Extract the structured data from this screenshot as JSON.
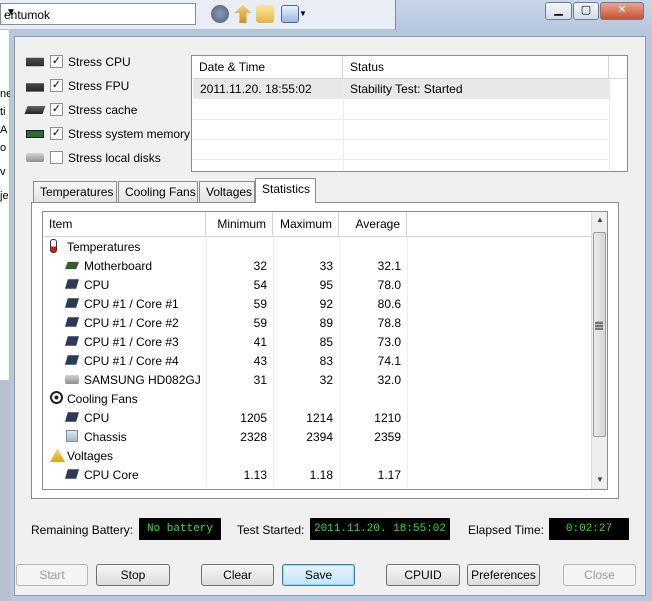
{
  "background_window": {
    "address_text": "entumok",
    "left_strip_texts": [
      "ne",
      "ti",
      "A",
      "o",
      "v",
      "je"
    ]
  },
  "stress_options": [
    {
      "icon": "cpu-chip-icon",
      "label": "Stress CPU",
      "checked": true
    },
    {
      "icon": "fpu-chip-icon",
      "label": "Stress FPU",
      "checked": true
    },
    {
      "icon": "cache-chip-icon",
      "label": "Stress cache",
      "checked": true
    },
    {
      "icon": "memory-module-icon",
      "label": "Stress system memory",
      "checked": true
    },
    {
      "icon": "hard-disk-icon",
      "label": "Stress local disks",
      "checked": false
    }
  ],
  "log": {
    "headers": {
      "datetime": "Date & Time",
      "status": "Status"
    },
    "rows": [
      {
        "datetime": "2011.11.20. 18:55:02",
        "status": "Stability Test: Started"
      }
    ]
  },
  "tabs": [
    {
      "label": "Temperatures",
      "active": false
    },
    {
      "label": "Cooling Fans",
      "active": false
    },
    {
      "label": "Voltages",
      "active": false
    },
    {
      "label": "Statistics",
      "active": true
    }
  ],
  "stats": {
    "headers": {
      "item": "Item",
      "min": "Minimum",
      "max": "Maximum",
      "avg": "Average"
    },
    "rows": [
      {
        "kind": "group",
        "icon": "thermometer-icon",
        "item": "Temperatures"
      },
      {
        "kind": "item",
        "icon": "motherboard-icon",
        "item": "Motherboard",
        "min": "32",
        "max": "33",
        "avg": "32.1"
      },
      {
        "kind": "item",
        "icon": "cpu-icon",
        "item": "CPU",
        "min": "54",
        "max": "95",
        "avg": "78.0"
      },
      {
        "kind": "item",
        "icon": "cpu-icon",
        "item": "CPU #1 / Core #1",
        "min": "59",
        "max": "92",
        "avg": "80.6"
      },
      {
        "kind": "item",
        "icon": "cpu-icon",
        "item": "CPU #1 / Core #2",
        "min": "59",
        "max": "89",
        "avg": "78.8"
      },
      {
        "kind": "item",
        "icon": "cpu-icon",
        "item": "CPU #1 / Core #3",
        "min": "41",
        "max": "85",
        "avg": "73.0"
      },
      {
        "kind": "item",
        "icon": "cpu-icon",
        "item": "CPU #1 / Core #4",
        "min": "43",
        "max": "83",
        "avg": "74.1"
      },
      {
        "kind": "item",
        "icon": "hard-disk-icon",
        "item": "SAMSUNG HD082GJ",
        "min": "31",
        "max": "32",
        "avg": "32.0"
      },
      {
        "kind": "group",
        "icon": "fan-icon",
        "item": "Cooling Fans"
      },
      {
        "kind": "item",
        "icon": "cpu-icon",
        "item": "CPU",
        "min": "1205",
        "max": "1214",
        "avg": "1210"
      },
      {
        "kind": "item",
        "icon": "chassis-icon",
        "item": "Chassis",
        "min": "2328",
        "max": "2394",
        "avg": "2359"
      },
      {
        "kind": "group",
        "icon": "warning-icon",
        "item": "Voltages"
      },
      {
        "kind": "item",
        "icon": "cpu-icon",
        "item": "CPU Core",
        "min": "1.13",
        "max": "1.18",
        "avg": "1.17"
      }
    ]
  },
  "status_bar": {
    "battery_label": "Remaining Battery:",
    "battery_value": "No battery",
    "started_label": "Test Started:",
    "started_value": "2011.11.20. 18:55:02",
    "elapsed_label": "Elapsed Time:",
    "elapsed_value": "0:02:27"
  },
  "buttons": {
    "start": "Start",
    "stop": "Stop",
    "clear": "Clear",
    "save": "Save",
    "cpuid": "CPUID",
    "preferences": "Preferences",
    "close": "Close"
  },
  "colors": {
    "lcd_text": "#29e629",
    "lcd_bg": "#000000",
    "window_frame": "#b7c7dd"
  }
}
